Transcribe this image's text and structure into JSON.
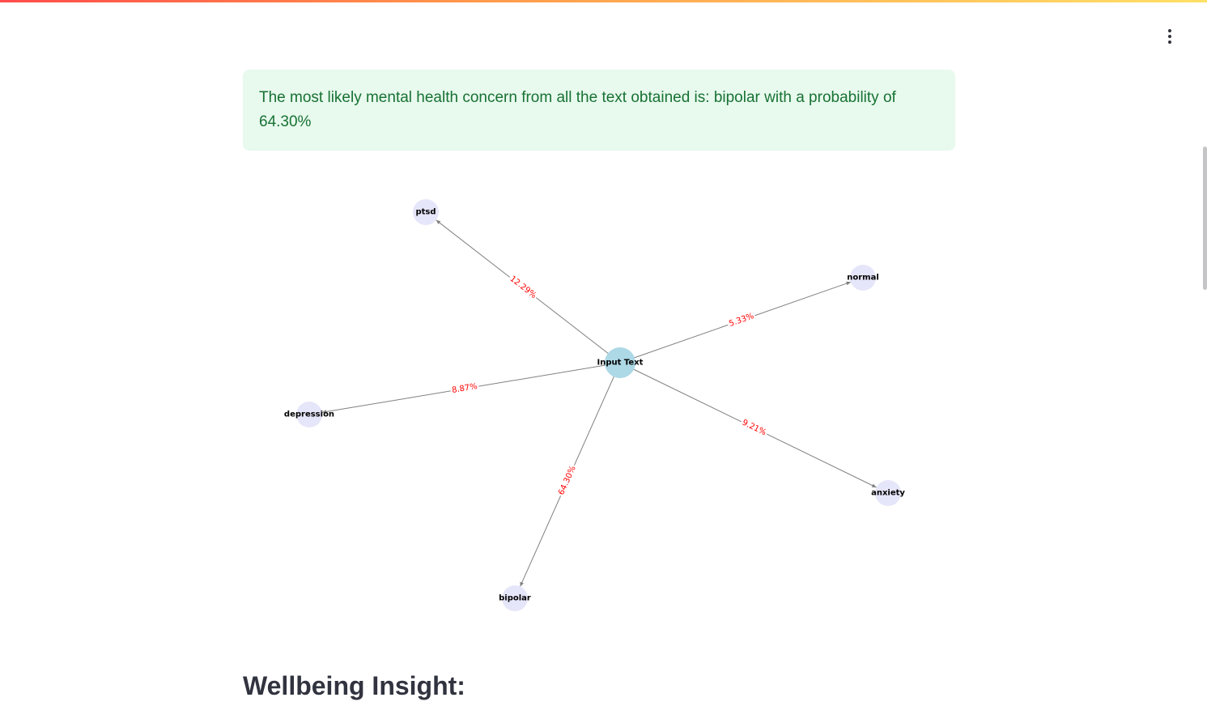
{
  "alert": {
    "text": "The most likely mental health concern from all the text obtained is: bipolar with a probability of 64.30%"
  },
  "colors": {
    "center_node": "#add8e6",
    "leaf_node": "#e6e6fa",
    "edge": "#808080",
    "edge_label": "#ff0000",
    "alert_bg": "#e8f9ee",
    "alert_text": "#177233"
  },
  "chart_data": {
    "type": "network-graph",
    "center": "Input Text",
    "edges": [
      {
        "target": "ptsd",
        "label": "12.29%",
        "value": 12.29
      },
      {
        "target": "normal",
        "label": "5.33%",
        "value": 5.33
      },
      {
        "target": "depression",
        "label": "8.87%",
        "value": 8.87
      },
      {
        "target": "anxiety",
        "label": "9.21%",
        "value": 9.21
      },
      {
        "target": "bipolar",
        "label": "64.30%",
        "value": 64.3
      }
    ]
  },
  "heading": {
    "text": "Wellbeing Insight:"
  },
  "menu": {
    "icon": "kebab-menu-icon"
  }
}
